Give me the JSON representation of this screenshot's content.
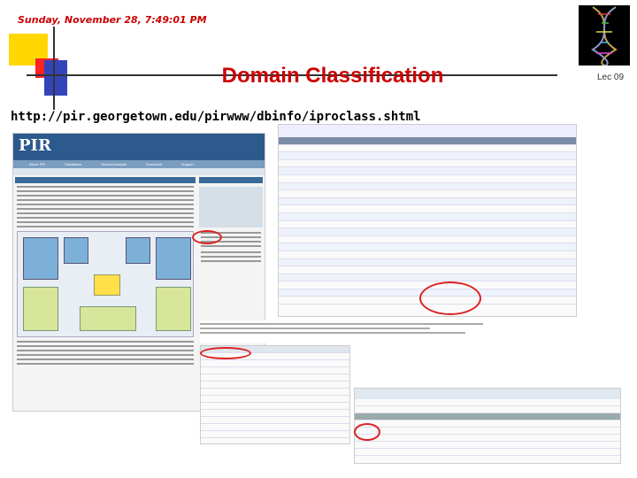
{
  "header": {
    "datetime": "Sunday, November 28, 7:49:01 PM",
    "title": "Domain Classification",
    "lecture": "Lec 09"
  },
  "url": "http://pir.georgetown.edu/pirwww/dbinfo/iproclass.shtml",
  "colors": {
    "title": "#cc0000",
    "datetime": "#cc0000",
    "annotation": "#dd2222"
  },
  "screenshot_left": {
    "logo": "PIR",
    "nav_items": [
      "About PIR",
      "Databases",
      "Search/Analysis",
      "Download",
      "Support"
    ]
  }
}
